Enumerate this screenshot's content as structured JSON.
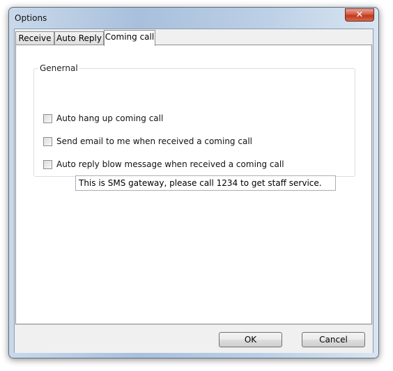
{
  "window": {
    "title": "Options"
  },
  "tabs": [
    {
      "label": "Receive",
      "active": false
    },
    {
      "label": "Auto Reply",
      "active": false
    },
    {
      "label": "Coming call",
      "active": true
    }
  ],
  "group": {
    "title": "Genernal",
    "options": [
      {
        "label": "Auto hang up coming call",
        "checked": false
      },
      {
        "label": "Send email to me when received a coming call",
        "checked": false
      },
      {
        "label": "Auto reply blow message when received a coming call",
        "checked": false
      }
    ],
    "reply_message": "This is SMS gateway, please call 1234 to get staff service."
  },
  "buttons": {
    "ok": "OK",
    "cancel": "Cancel"
  },
  "icons": {
    "close": "close-icon"
  },
  "colors": {
    "window_frame": "#a8c0dc",
    "close_button": "#c0381e",
    "panel_background": "#ffffff",
    "dialog_background": "#f0f0f0"
  }
}
